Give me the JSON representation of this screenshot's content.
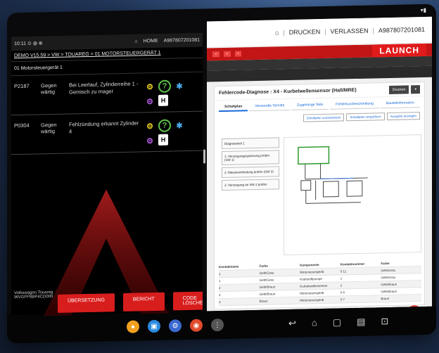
{
  "device": {
    "top_status": "▾▮"
  },
  "left": {
    "status_time": "10:11 ⊙ ◍ ⊕",
    "status_home": "HOME",
    "status_serial": "A987807201081",
    "breadcrumb": "DEMO V15.59 > VW > TOUAREG > 01 MOTORSTEUERGERÄT 1",
    "section": "01 Motorsteuergerät 1",
    "dtcs": [
      {
        "code": "P2187",
        "status": "Gegen wärtig",
        "desc": "Bei Leerlauf, Zylinderreihe 1 - Gemisch zu mager"
      },
      {
        "code": "P0304",
        "status": "Gegen wärtig",
        "desc": "Fehlzündung erkannt Zylinder 4"
      }
    ],
    "vehicle": "Volkswagen Touareg",
    "vin": "WVGFP9BP4CD000",
    "buttons": {
      "translate": "ÜBERSETZUNG",
      "report": "BERICHT",
      "clear": "CODE LÖSCHEN"
    }
  },
  "right": {
    "drucken": "DRUCKEN",
    "verlassen": "VERLASSEN",
    "serial": "A987807201081",
    "brand": "LAUNCH",
    "card_title": "Fehlercode-Diagnose : X4 - Kurbelwellensensor (Hall/MRE)",
    "card_btn": "Drucken",
    "tabs": [
      "Schaltplan",
      "Verwandte Schritte",
      "Zugehörige Teile",
      "Fehlerkurzbeschreibung",
      "Bauteilinformation"
    ],
    "tools": [
      "Schaltplan zurücksetzen",
      "Schaltplan vergrößern",
      "Ausgabe anzeigen"
    ],
    "steps": [
      "Diagnoseteil 1",
      "1: Versorgungsspannung prüfen (SW 1)",
      "2: Masseverbindung prüfen (SW 3)",
      "3: Versorgung an SW 2 prüfen"
    ],
    "table": {
      "headers": [
        "Kontaktname",
        "Farbe",
        "Komponente",
        "Kontaktnummer",
        "Farbe"
      ],
      "rows": [
        [
          "1",
          "Gelb/Grau",
          "Motorsteuergerät",
          "0 11",
          "Gelb/Grau"
        ],
        [
          "1",
          "Gelb/Grau",
          "Kraftstoffpumpe",
          "1",
          "Gelb/Grau"
        ],
        [
          "2",
          "Gelb/Braun",
          "Kurbelwellensensor",
          "2",
          "Gelb/Braun"
        ],
        [
          "3",
          "Gelb/Braun",
          "Motorsteuergerät",
          "0 6",
          "Gelb/Braun"
        ],
        [
          "3",
          "Braun",
          "Motorsteuergerät",
          "0 7",
          "Braun"
        ]
      ]
    }
  }
}
